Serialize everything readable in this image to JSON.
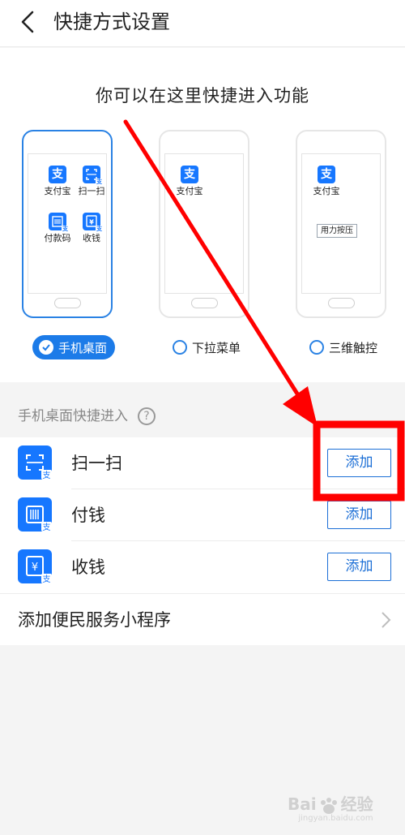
{
  "header": {
    "title": "快捷方式设置"
  },
  "intro": {
    "subtitle": "你可以在这里快捷进入功能"
  },
  "phones": [
    {
      "apps": [
        {
          "label": "支付宝"
        },
        {
          "label": "扫一扫"
        },
        {
          "label": "付款码"
        },
        {
          "label": "收钱"
        }
      ]
    },
    {
      "apps": [
        {
          "label": "支付宝"
        }
      ]
    },
    {
      "apps": [
        {
          "label": "支付宝"
        }
      ],
      "press_label": "用力按压"
    }
  ],
  "options": [
    {
      "label": "手机桌面",
      "selected": true
    },
    {
      "label": "下拉菜单",
      "selected": false
    },
    {
      "label": "三维触控",
      "selected": false
    }
  ],
  "section": {
    "label": "手机桌面快捷进入"
  },
  "shortcuts": [
    {
      "label": "扫一扫",
      "button": "添加",
      "icon": "scan-icon"
    },
    {
      "label": "付钱",
      "button": "添加",
      "icon": "pay-code-icon"
    },
    {
      "label": "收钱",
      "button": "添加",
      "icon": "receive-money-icon"
    }
  ],
  "mini_programs": {
    "label": "添加便民服务小程序"
  },
  "watermark": {
    "brand": "Bai",
    "brand_tail": "经验",
    "url": "jingyan.baidu.com"
  },
  "colors": {
    "accent": "#1c7be8",
    "icon_blue": "#1677ff",
    "annotation": "#ff0000"
  }
}
